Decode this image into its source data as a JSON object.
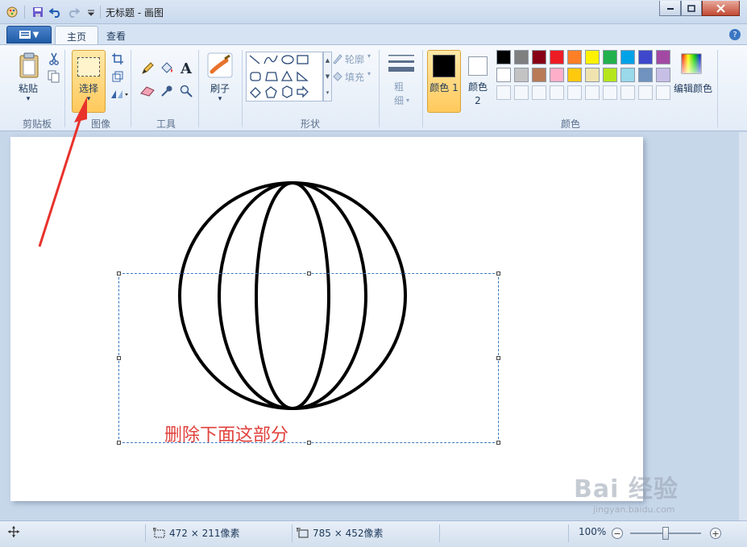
{
  "window": {
    "title": "无标题 - 画图"
  },
  "tabs": {
    "home": "主页",
    "view": "查看"
  },
  "ribbon": {
    "clipboard": {
      "paste": "粘贴",
      "group": "剪贴板"
    },
    "image": {
      "select": "选择",
      "group": "图像"
    },
    "tools": {
      "group": "工具"
    },
    "brushes": {
      "label": "刷子"
    },
    "shapes": {
      "outline": "轮廓",
      "fill": "填充",
      "group": "形状"
    },
    "size": {
      "label": "粗细"
    },
    "colors": {
      "color1": "颜色 1",
      "color2": "颜色 2",
      "edit": "编辑颜色",
      "group": "颜色",
      "row1": [
        "#000000",
        "#7f7f7f",
        "#880015",
        "#ed1c24",
        "#ff7f27",
        "#fff200",
        "#22b14c",
        "#00a2e8",
        "#3f48cc",
        "#a349a4"
      ],
      "row2": [
        "#ffffff",
        "#c3c3c3",
        "#b97a57",
        "#ffaec9",
        "#ffc90e",
        "#efe4b0",
        "#b5e61d",
        "#99d9ea",
        "#7092be",
        "#c8bfe7"
      ]
    }
  },
  "canvas": {
    "annotation": "删除下面这部分"
  },
  "status": {
    "selection_size": "472 × 211像素",
    "canvas_size": "785 × 452像素",
    "zoom": "100%",
    "zoom_level": 1.0
  },
  "watermark": {
    "brand": "Bai 经验",
    "url": "jingyan.baidu.com"
  }
}
